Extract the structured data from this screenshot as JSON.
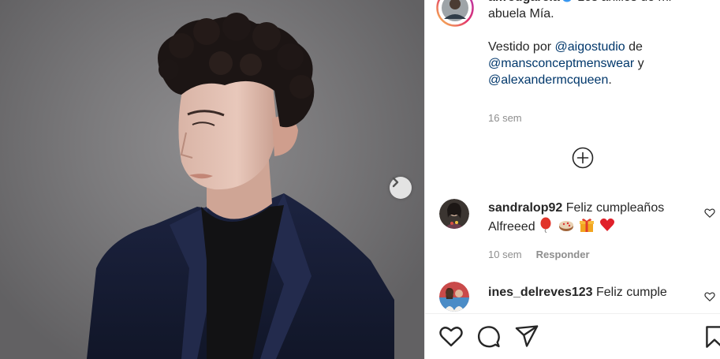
{
  "post": {
    "username": "alfredgarcia",
    "caption_line1": "Los anillos de mi abuela Mía.",
    "caption_prefix": "Vestido por",
    "mention1": "@aigostudio",
    "word_de": "de",
    "mention2": "@mansconceptmenswear",
    "word_y": "y",
    "mention3": "@alexandermcqueen",
    "end_period": ".",
    "time": "16 sem"
  },
  "comments": [
    {
      "username": "sandralop92",
      "text": "Feliz cumpleaños Alfreeed",
      "emojis": [
        "balloon-emoji",
        "cake-emoji",
        "gift-emoji",
        "red-heart-emoji"
      ],
      "time": "10 sem",
      "reply_label": "Responder"
    },
    {
      "username": "ines_delreves123",
      "text": "Feliz cumple"
    }
  ],
  "icons": {
    "verified": "verified-badge-icon",
    "next": "chevron-right-icon",
    "load_more": "plus-circle-icon",
    "like": "heart-icon",
    "comment": "comment-bubble-icon",
    "share": "paper-plane-icon",
    "save": "bookmark-icon"
  },
  "colors": {
    "verified": "#3897f0",
    "link": "#00376b",
    "muted": "#8e8e8e",
    "text": "#262626"
  }
}
